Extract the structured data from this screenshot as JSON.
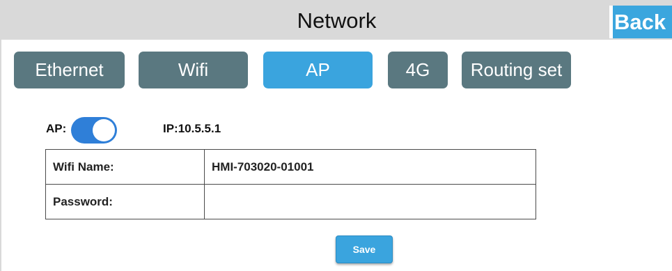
{
  "header": {
    "title": "Network",
    "back_label": "Back"
  },
  "tabs": [
    {
      "label": "Ethernet",
      "active": false
    },
    {
      "label": "Wifi",
      "active": false
    },
    {
      "label": "AP",
      "active": true
    },
    {
      "label": "4G",
      "active": false
    },
    {
      "label": "Routing set",
      "active": false
    }
  ],
  "ap": {
    "label": "AP:",
    "enabled": true,
    "ip_text": "IP:10.5.5.1"
  },
  "settings": {
    "rows": [
      {
        "key": "Wifi Name:",
        "value": "HMI-703020-01001"
      },
      {
        "key": "Password:",
        "value": ""
      }
    ]
  },
  "actions": {
    "save_label": "Save"
  },
  "colors": {
    "header_bg": "#d9d9d9",
    "tab_inactive": "#5a7880",
    "tab_active": "#3aa4de",
    "toggle_on": "#2f7fd8",
    "accent": "#3ba6de"
  }
}
